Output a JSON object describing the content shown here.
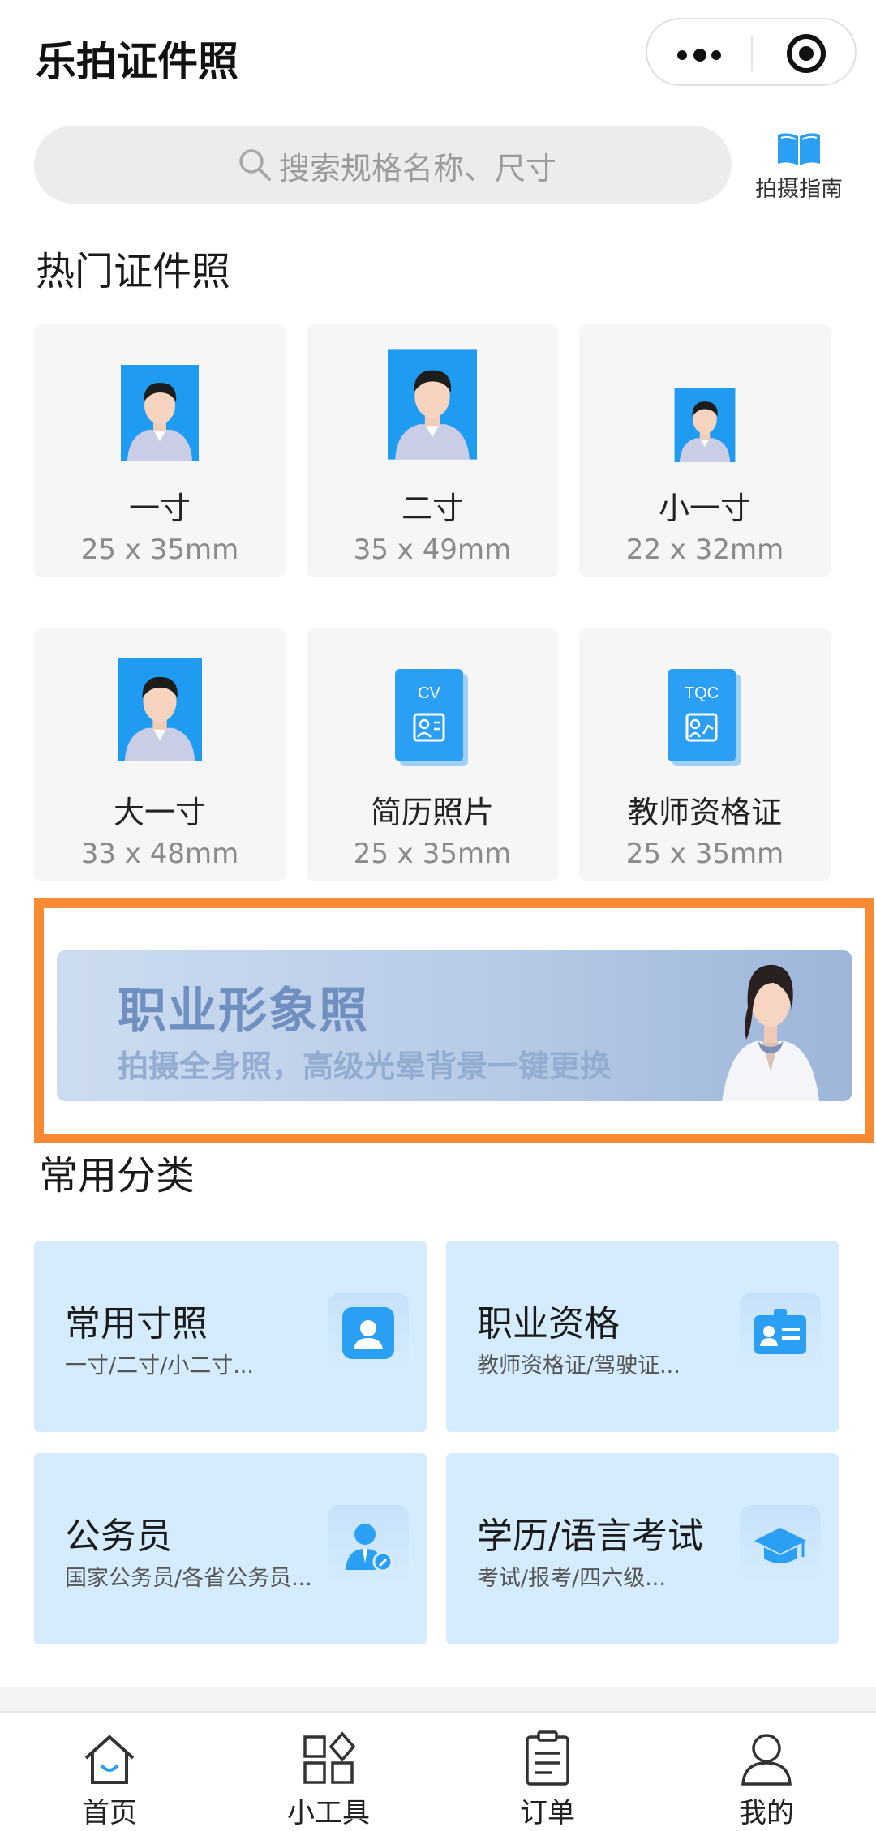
{
  "app": {
    "title": "乐拍证件照"
  },
  "search": {
    "placeholder": "搜索规格名称、尺寸"
  },
  "guide": {
    "label": "拍摄指南"
  },
  "hot": {
    "title": "热门证件照",
    "items": [
      {
        "name": "一寸",
        "size": "25 x 35mm",
        "icon": "portrait-photo-icon"
      },
      {
        "name": "二寸",
        "size": "35 x 49mm",
        "icon": "portrait-photo-icon"
      },
      {
        "name": "小一寸",
        "size": "22 x 32mm",
        "icon": "portrait-photo-icon"
      },
      {
        "name": "大一寸",
        "size": "33 x 48mm",
        "icon": "portrait-photo-icon"
      },
      {
        "name": "简历照片",
        "size": "25 x 35mm",
        "icon": "cv-card-icon",
        "badge": "CV"
      },
      {
        "name": "教师资格证",
        "size": "25 x 35mm",
        "icon": "tqc-card-icon",
        "badge": "TQC"
      }
    ]
  },
  "banner": {
    "title": "职业形象照",
    "subtitle": "拍摄全身照，高级光晕背景一键更换"
  },
  "categories": {
    "title": "常用分类",
    "items": [
      {
        "title": "常用寸照",
        "sub": "一寸/二寸/小二寸...",
        "icon": "user-icon"
      },
      {
        "title": "职业资格",
        "sub": "教师资格证/驾驶证...",
        "icon": "id-card-icon"
      },
      {
        "title": "公务员",
        "sub": "国家公务员/各省公务员...",
        "icon": "officer-icon"
      },
      {
        "title": "学历/语言考试",
        "sub": "考试/报考/四六级...",
        "icon": "graduation-cap-icon"
      }
    ]
  },
  "tabs": [
    {
      "label": "首页",
      "icon": "home-icon",
      "active": true
    },
    {
      "label": "小工具",
      "icon": "tools-icon"
    },
    {
      "label": "订单",
      "icon": "order-icon"
    },
    {
      "label": "我的",
      "icon": "profile-icon"
    }
  ],
  "colors": {
    "accent": "#2b9ff3",
    "photo_bg": "#1f9bf2",
    "category_bg": "#d4ecfd",
    "banner_frame": "#f98a34"
  }
}
